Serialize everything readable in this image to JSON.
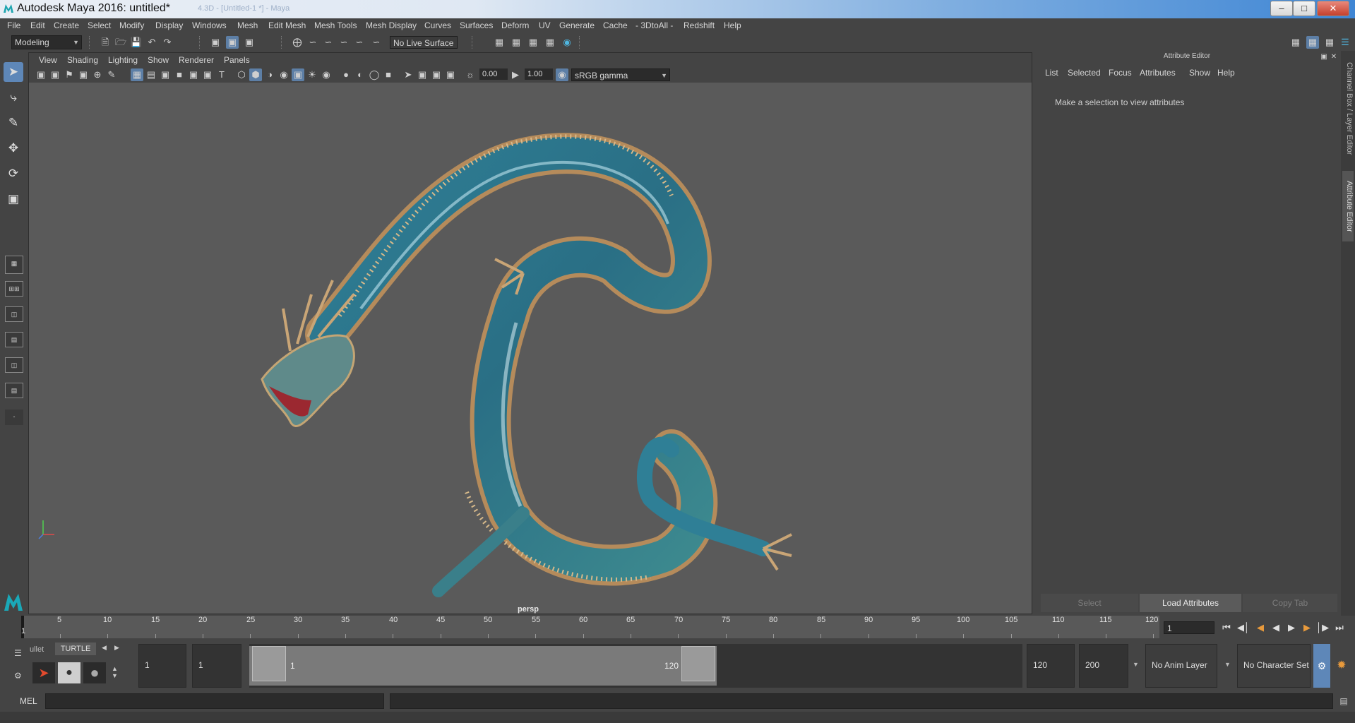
{
  "window": {
    "title": "Autodesk Maya 2016: untitled*",
    "ghost_title": "4.3D - [Untitled-1 *] - Maya"
  },
  "menubar": [
    "File",
    "Edit",
    "Create",
    "Select",
    "Modify",
    "Display",
    "Windows",
    "Mesh",
    "Edit Mesh",
    "Mesh Tools",
    "Mesh Display",
    "Curves",
    "Surfaces",
    "Deform",
    "UV",
    "Generate",
    "Cache",
    "- 3DtoAll -",
    "Redshift",
    "Help"
  ],
  "statusline": {
    "mode": "Modeling",
    "live_surface": "No Live Surface"
  },
  "panel_menu": [
    "View",
    "Shading",
    "Lighting",
    "Show",
    "Renderer",
    "Panels"
  ],
  "panel_toolbar": {
    "exposure": "0.00",
    "gamma": "1.00",
    "color_space": "sRGB gamma"
  },
  "viewport": {
    "camera": "persp"
  },
  "attribute_editor": {
    "header": "Attribute Editor",
    "menu": [
      "List",
      "Selected",
      "Focus",
      "Attributes",
      "Show",
      "Help"
    ],
    "message": "Make a selection to view attributes",
    "buttons": {
      "select": "Select",
      "load": "Load Attributes",
      "copy": "Copy Tab"
    }
  },
  "side_tabs": {
    "channel_box": "Channel Box / Layer Editor",
    "attribute_editor": "Attribute Editor"
  },
  "timeline": {
    "ticks": [
      "1",
      "5",
      "10",
      "15",
      "20",
      "25",
      "30",
      "35",
      "40",
      "45",
      "50",
      "55",
      "60",
      "65",
      "70",
      "75",
      "80",
      "85",
      "90",
      "95",
      "100",
      "105",
      "110",
      "115",
      "120"
    ],
    "current_frame": "1"
  },
  "shelf": {
    "tab_prev": "ullet",
    "tab_current": "TURTLE"
  },
  "range": {
    "start": "1",
    "playback_start": "1",
    "handle_start": "1",
    "handle_end": "120",
    "playback_end": "120",
    "end": "200",
    "anim_layer": "No Anim Layer",
    "character_set": "No Character Set"
  },
  "cmdline": {
    "label": "MEL"
  },
  "colors": {
    "accent": "#5e87b8",
    "viewport_bg": "#5a5a5a",
    "panel": "#444444"
  }
}
